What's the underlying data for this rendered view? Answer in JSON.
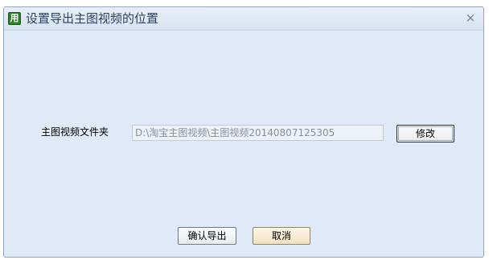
{
  "window": {
    "title": "设置导出主图视频的位置",
    "app_icon_glyph": "用",
    "close_glyph": "×",
    "accent_color": "#2f7d2a"
  },
  "form": {
    "folder_label": "主图视频文件夹",
    "folder_path": "D:\\淘宝主图视频\\主图视频20140807125305",
    "modify_label": "修改"
  },
  "footer": {
    "export_label": "确认导出",
    "cancel_label": "取消"
  }
}
